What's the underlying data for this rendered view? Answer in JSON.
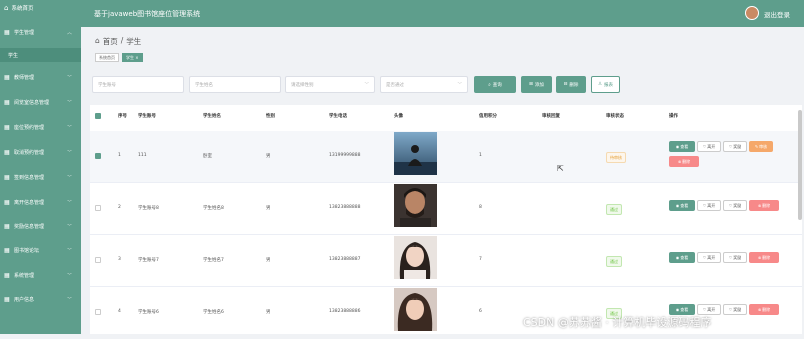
{
  "colors": {
    "primary": "#5e9e8c",
    "danger": "#f78989",
    "warning": "#f5a86a"
  },
  "sidebar": {
    "brand_icon": "home-icon",
    "brand": "系统首页",
    "items": [
      {
        "label": "学生管理",
        "icon": "grid-icon"
      },
      {
        "label": "教师管理",
        "icon": "grid-icon"
      },
      {
        "label": "阅览室信息管理",
        "icon": "grid-icon"
      },
      {
        "label": "座位预约管理",
        "icon": "grid-icon"
      },
      {
        "label": "取消预约管理",
        "icon": "grid-icon"
      },
      {
        "label": "签到信息管理",
        "icon": "grid-icon"
      },
      {
        "label": "离开信息管理",
        "icon": "grid-icon"
      },
      {
        "label": "奖励信息管理",
        "icon": "grid-icon"
      },
      {
        "label": "图书馆论坛",
        "icon": "grid-icon"
      },
      {
        "label": "系统管理",
        "icon": "grid-icon"
      },
      {
        "label": "用户信息",
        "icon": "grid-icon"
      }
    ],
    "sub_item": "学生"
  },
  "header": {
    "title": "基于javaweb图书馆座位管理系统",
    "logout": "退出登录"
  },
  "breadcrumb": {
    "home": "首页",
    "sep": "/",
    "current": "学生"
  },
  "tags": [
    {
      "label": "系统首页"
    },
    {
      "label": "学生 ×"
    }
  ],
  "filters": {
    "student_no": "学生账号",
    "student_name": "学生姓名",
    "gender": "请选择性别",
    "review": "是否通过"
  },
  "buttons": {
    "query": "查询",
    "add": "添加",
    "delete": "删除",
    "report": "报表"
  },
  "table": {
    "headers": [
      "序号",
      "学生账号",
      "学生姓名",
      "性别",
      "学生电话",
      "头像",
      "信用积分",
      "审核回复",
      "审核状态",
      "操作"
    ],
    "rows": [
      {
        "index": "1",
        "account": "111",
        "name": "卧室",
        "gender": "男",
        "phone": "13199999888",
        "credit": "1",
        "reply": "",
        "status": "待审核",
        "status_type": "pending"
      },
      {
        "index": "2",
        "account": "学生账号8",
        "name": "学生姓名8",
        "gender": "男",
        "phone": "13823888888",
        "credit": "8",
        "reply": "",
        "status": "通过",
        "status_type": "pass"
      },
      {
        "index": "3",
        "account": "学生账号7",
        "name": "学生姓名7",
        "gender": "男",
        "phone": "13823888887",
        "credit": "7",
        "reply": "",
        "status": "通过",
        "status_type": "pass"
      },
      {
        "index": "4",
        "account": "学生账号6",
        "name": "学生姓名6",
        "gender": "男",
        "phone": "13823888886",
        "credit": "6",
        "reply": "",
        "status": "通过",
        "status_type": "pass"
      }
    ],
    "actions": {
      "view": "查看",
      "leave": "离开",
      "reward": "奖励",
      "audit": "审核",
      "delete": "删除"
    }
  },
  "watermark": "CSDN @苏苏酱 · 计算机毕设源码程序"
}
